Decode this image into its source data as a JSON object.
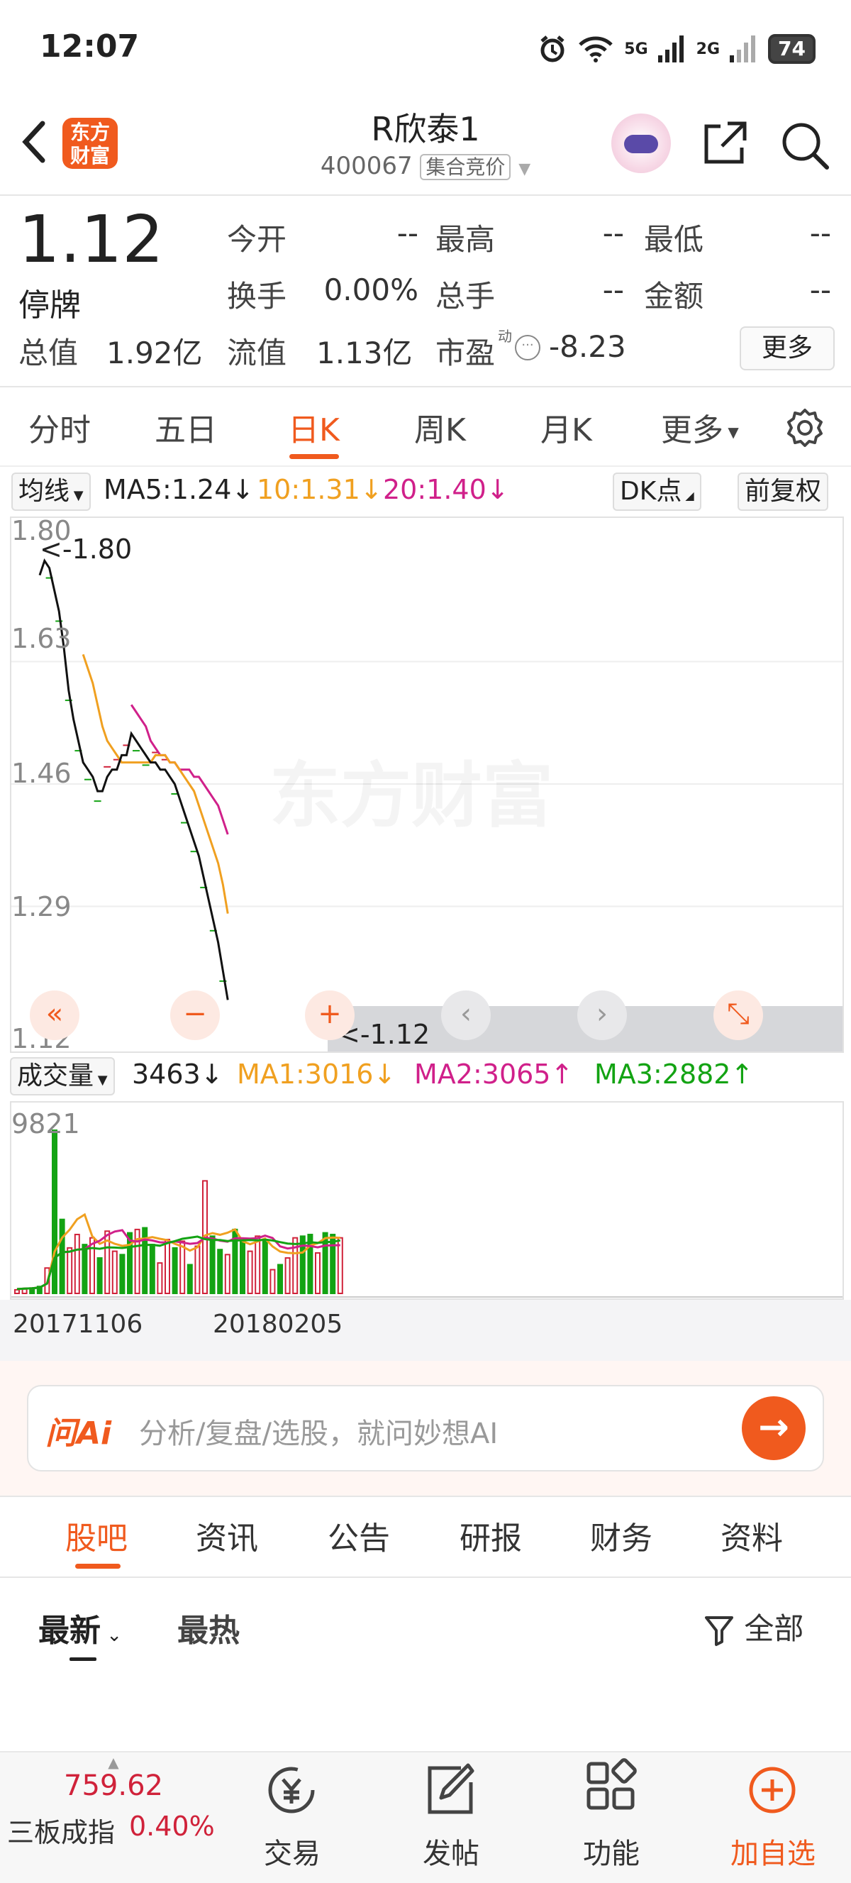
{
  "status_bar": {
    "time": "12:07",
    "network_5g": "5G",
    "network_2g": "2G",
    "battery": "74"
  },
  "header": {
    "logo_text": "东方财富",
    "title": "R欣泰1",
    "code": "400067",
    "phase": "集合竞价"
  },
  "quote": {
    "price": "1.12",
    "status": "停牌",
    "fields": [
      {
        "label": "今开",
        "value": "--"
      },
      {
        "label": "最高",
        "value": "--"
      },
      {
        "label": "最低",
        "value": "--"
      },
      {
        "label": "换手",
        "value": "0.00%"
      },
      {
        "label": "总手",
        "value": "--"
      },
      {
        "label": "金额",
        "value": "--"
      }
    ],
    "total_value_label": "总值",
    "total_value": "1.92亿",
    "float_value_label": "流值",
    "float_value": "1.13亿",
    "pe_label": "市盈",
    "pe_sup": "动",
    "pe_value": "-8.23",
    "more": "更多"
  },
  "chart_tabs": [
    "分时",
    "五日",
    "日K",
    "周K",
    "月K",
    "更多"
  ],
  "ma_row": {
    "selector": "均线",
    "ma5": "MA5:1.24",
    "ma10": "10:1.31",
    "ma20": "20:1.40",
    "dk": "DK点",
    "adjust": "前复权"
  },
  "volume_row": {
    "selector": "成交量",
    "vol": "3463",
    "ma1": "MA1:3016",
    "ma2": "MA2:3065",
    "ma3": "MA3:2882"
  },
  "colors": {
    "accent": "#f05a1e",
    "up": "#d0223a",
    "down": "#13a313",
    "ma5": "#111111",
    "ma10": "#f0a020",
    "ma20": "#d0208a"
  },
  "chart_data": [
    {
      "type": "candlestick",
      "y_ticks": [
        "1.80",
        "1.63",
        "1.46",
        "1.29",
        "1.12"
      ],
      "ylim": [
        1.12,
        1.8
      ],
      "max_marker": "<-1.80",
      "min_marker": "<-1.12",
      "watermark": "东方财富",
      "close": [
        1.75,
        1.77,
        1.76,
        1.73,
        1.7,
        1.65,
        1.59,
        1.55,
        1.52,
        1.49,
        1.48,
        1.47,
        1.45,
        1.45,
        1.47,
        1.48,
        1.48,
        1.5,
        1.5,
        1.53,
        1.52,
        1.51,
        1.5,
        1.49,
        1.49,
        1.48,
        1.48,
        1.47,
        1.46,
        1.44,
        1.42,
        1.4,
        1.38,
        1.36,
        1.33,
        1.3,
        1.27,
        1.24,
        1.2,
        1.16
      ],
      "ma10": [
        null,
        null,
        null,
        null,
        null,
        null,
        null,
        null,
        null,
        1.64,
        1.62,
        1.6,
        1.57,
        1.54,
        1.52,
        1.51,
        1.5,
        1.49,
        1.49,
        1.49,
        1.49,
        1.49,
        1.49,
        1.49,
        1.5,
        1.5,
        1.5,
        1.49,
        1.49,
        1.48,
        1.47,
        1.46,
        1.45,
        1.43,
        1.41,
        1.39,
        1.37,
        1.35,
        1.32,
        1.28
      ],
      "ma20": [
        null,
        null,
        null,
        null,
        null,
        null,
        null,
        null,
        null,
        null,
        null,
        null,
        null,
        null,
        null,
        null,
        null,
        null,
        null,
        1.57,
        1.56,
        1.55,
        1.54,
        1.52,
        1.51,
        1.5,
        1.5,
        1.49,
        1.49,
        1.48,
        1.48,
        1.48,
        1.47,
        1.47,
        1.46,
        1.45,
        1.44,
        1.43,
        1.41,
        1.39
      ]
    },
    {
      "type": "bar",
      "y_ticks": [
        "9821"
      ],
      "x_ticks": [
        "20171106",
        "20180205"
      ],
      "volume": [
        300,
        350,
        400,
        500,
        1600,
        9821,
        4500,
        2800,
        3600,
        3000,
        3400,
        2200,
        3800,
        2600,
        2400,
        3700,
        3900,
        4000,
        3000,
        1900,
        3300,
        2800,
        3200,
        1800,
        2900,
        6800,
        3500,
        2700,
        2400,
        3900,
        3300,
        2600,
        3500,
        3300,
        1500,
        1800,
        2200,
        3400,
        3500,
        3600,
        2500,
        3700,
        3600,
        3400
      ]
    }
  ],
  "chart_nav": [
    "«",
    "−",
    "+",
    "‹",
    "›",
    "⤡"
  ],
  "ai": {
    "logo": "问Ai",
    "placeholder": "分析/复盘/选股，就问妙想AI"
  },
  "content_tabs": [
    "股吧",
    "资讯",
    "公告",
    "研报",
    "财务",
    "资料"
  ],
  "sort": {
    "latest": "最新",
    "hot": "最热",
    "filter": "全部"
  },
  "bottom_bar": {
    "index_value": "759.62",
    "index_name": "三板成指",
    "index_change": "0.40%",
    "items": [
      "交易",
      "发帖",
      "功能",
      "加自选"
    ]
  }
}
